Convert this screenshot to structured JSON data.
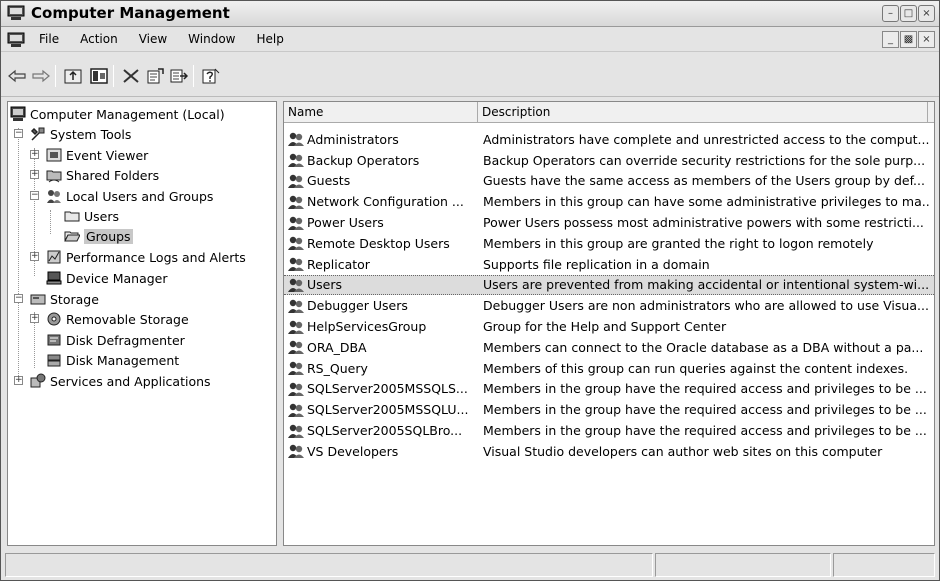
{
  "window": {
    "title": "Computer Management"
  },
  "menu": {
    "items": [
      "File",
      "Action",
      "View",
      "Window",
      "Help"
    ]
  },
  "toolbar": {
    "buttons": [
      "back-icon",
      "forward-icon",
      "up-one-level-icon",
      "show-hide-tree-icon",
      "delete-icon",
      "properties-icon",
      "export-list-icon",
      "help-icon"
    ]
  },
  "tree": {
    "root": "Computer Management (Local)",
    "system_tools": "System Tools",
    "event_viewer": "Event Viewer",
    "shared_folders": "Shared Folders",
    "local_users_groups": "Local Users and Groups",
    "users": "Users",
    "groups": "Groups",
    "perf_logs": "Performance Logs and Alerts",
    "device_manager": "Device Manager",
    "storage": "Storage",
    "removable_storage": "Removable Storage",
    "disk_defrag": "Disk Defragmenter",
    "disk_mgmt": "Disk Management",
    "services_apps": "Services and Applications"
  },
  "list": {
    "columns": [
      "Name",
      "Description"
    ],
    "rows": [
      {
        "name": "Administrators",
        "description": "Administrators have complete and unrestricted access to the comput..."
      },
      {
        "name": "Backup Operators",
        "description": "Backup Operators can override security restrictions for the sole purp..."
      },
      {
        "name": "Guests",
        "description": "Guests have the same access as members of the Users group by def..."
      },
      {
        "name": "Network Configuration ...",
        "description": "Members in this group can have some administrative privileges to ma..."
      },
      {
        "name": "Power Users",
        "description": "Power Users possess most administrative powers with some restricti..."
      },
      {
        "name": "Remote Desktop Users",
        "description": "Members in this group are granted the right to logon remotely"
      },
      {
        "name": "Replicator",
        "description": "Supports file replication in a domain"
      },
      {
        "name": "Users",
        "description": "Users are prevented from making accidental or intentional system-wi..."
      },
      {
        "name": "Debugger Users",
        "description": "Debugger Users are non administrators who are allowed to use Visua..."
      },
      {
        "name": "HelpServicesGroup",
        "description": "Group for the Help and Support Center"
      },
      {
        "name": "ORA_DBA",
        "description": "Members can connect to the Oracle database as a DBA without a pa..."
      },
      {
        "name": "RS_Query",
        "description": "Members of this group can run queries against the content indexes."
      },
      {
        "name": "SQLServer2005MSSQLS...",
        "description": "Members in the group have the required access and privileges to be ..."
      },
      {
        "name": "SQLServer2005MSSQLU...",
        "description": "Members in the group have the required access and privileges to be ..."
      },
      {
        "name": "SQLServer2005SQLBro...",
        "description": "Members in the group have the required access and privileges to be ..."
      },
      {
        "name": "VS Developers",
        "description": "Visual Studio developers can author web sites on this computer"
      }
    ]
  }
}
